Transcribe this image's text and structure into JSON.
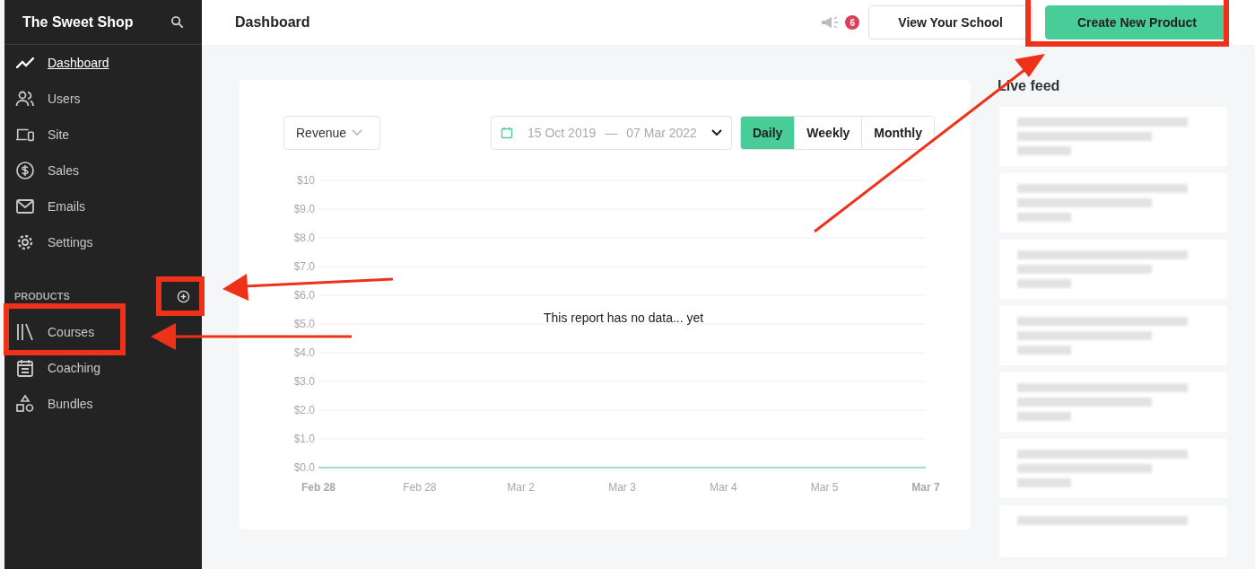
{
  "sidebar": {
    "title": "The Sweet Shop",
    "items": [
      {
        "label": "Dashboard",
        "selected": true
      },
      {
        "label": "Users",
        "selected": false
      },
      {
        "label": "Site",
        "selected": false
      },
      {
        "label": "Sales",
        "selected": false
      },
      {
        "label": "Emails",
        "selected": false
      },
      {
        "label": "Settings",
        "selected": false
      }
    ],
    "section": {
      "title": "PRODUCTS",
      "items": [
        {
          "label": "Courses",
          "selected": false
        },
        {
          "label": "Coaching",
          "selected": false
        },
        {
          "label": "Bundles",
          "selected": false
        }
      ]
    }
  },
  "header": {
    "title": "Dashboard",
    "notification_count": "6",
    "buttons": [
      {
        "label": "View Your School",
        "kind": "secondary"
      },
      {
        "label": "Create New Product",
        "kind": "primary"
      }
    ]
  },
  "report": {
    "metric": "Revenue",
    "date_from": "15 Oct 2019",
    "date_sep": "—",
    "date_to": "07 Mar 2022",
    "periods": [
      {
        "label": "Daily",
        "selected": true
      },
      {
        "label": "Weekly",
        "selected": false
      },
      {
        "label": "Monthly",
        "selected": false
      }
    ],
    "empty_message": "This report has no data... yet",
    "chart_data": {
      "type": "line",
      "categories": [
        "Feb 28",
        "Feb 28",
        "Mar 2",
        "Mar 3",
        "Mar 4",
        "Mar 5",
        "Mar 7"
      ],
      "yticks": [
        {
          "value": 0,
          "label": "$0.0"
        },
        {
          "value": 1,
          "label": "$1.0"
        },
        {
          "value": 2,
          "label": "$2.0"
        },
        {
          "value": 3,
          "label": "$3.0"
        },
        {
          "value": 4,
          "label": "$4.0"
        },
        {
          "value": 5,
          "label": "$5.0"
        },
        {
          "value": 6,
          "label": "$6.0"
        },
        {
          "value": 7,
          "label": "$7.0"
        },
        {
          "value": 8,
          "label": "$8.0"
        },
        {
          "value": 9,
          "label": "$9.0"
        },
        {
          "value": 10,
          "label": "$10"
        }
      ],
      "ylim": [
        0,
        10
      ],
      "grid": true,
      "series": [
        {
          "color": "#9fdcd6",
          "values": [
            0,
            0,
            0,
            0,
            0,
            0,
            0
          ]
        }
      ]
    }
  },
  "live_feed": {
    "title": "Live feed"
  }
}
